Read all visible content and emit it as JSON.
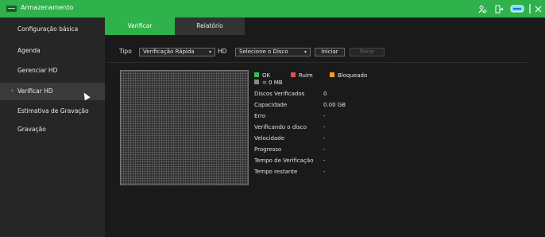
{
  "window": {
    "title": "Armazenamento"
  },
  "sidebar": {
    "items": [
      {
        "label": "Configuração básica"
      },
      {
        "label": "Agenda"
      },
      {
        "label": "Gerenciar HD"
      },
      {
        "label": "Verificar HD",
        "arrow": "›"
      },
      {
        "label": "Estimativa de Gravação"
      },
      {
        "label": "Gravação"
      }
    ]
  },
  "tabs": [
    {
      "label": "Verificar"
    },
    {
      "label": "Relatório"
    }
  ],
  "controls": {
    "tipo_label": "Tipo",
    "tipo_value": "Verificação Rápida",
    "hd_label": "HD",
    "hd_value": "Selecione o Disco",
    "iniciar": "Iniciar",
    "parar": "Parar"
  },
  "legend": {
    "ok": "OK",
    "ruim": "Ruim",
    "bloqueado": "Bloqueado",
    "unit": "= 0 MB",
    "colors": {
      "ok": "#36c04f",
      "ruim": "#e84c4c",
      "bloqueado": "#f0a020",
      "unit": "#888888"
    }
  },
  "info": [
    {
      "label": "Discos Verificados",
      "value": "0"
    },
    {
      "label": "Capacidade",
      "value": "0.00 GB"
    },
    {
      "label": "Erro",
      "value": "-"
    },
    {
      "label": "Verificando o disco",
      "value": "-"
    },
    {
      "label": "Velocidade",
      "value": "-"
    },
    {
      "label": "Progresso",
      "value": "-"
    },
    {
      "label": "Tempo de Verificação",
      "value": "-"
    },
    {
      "label": "Tempo restante",
      "value": "-"
    }
  ],
  "accent": "#2fb14b"
}
